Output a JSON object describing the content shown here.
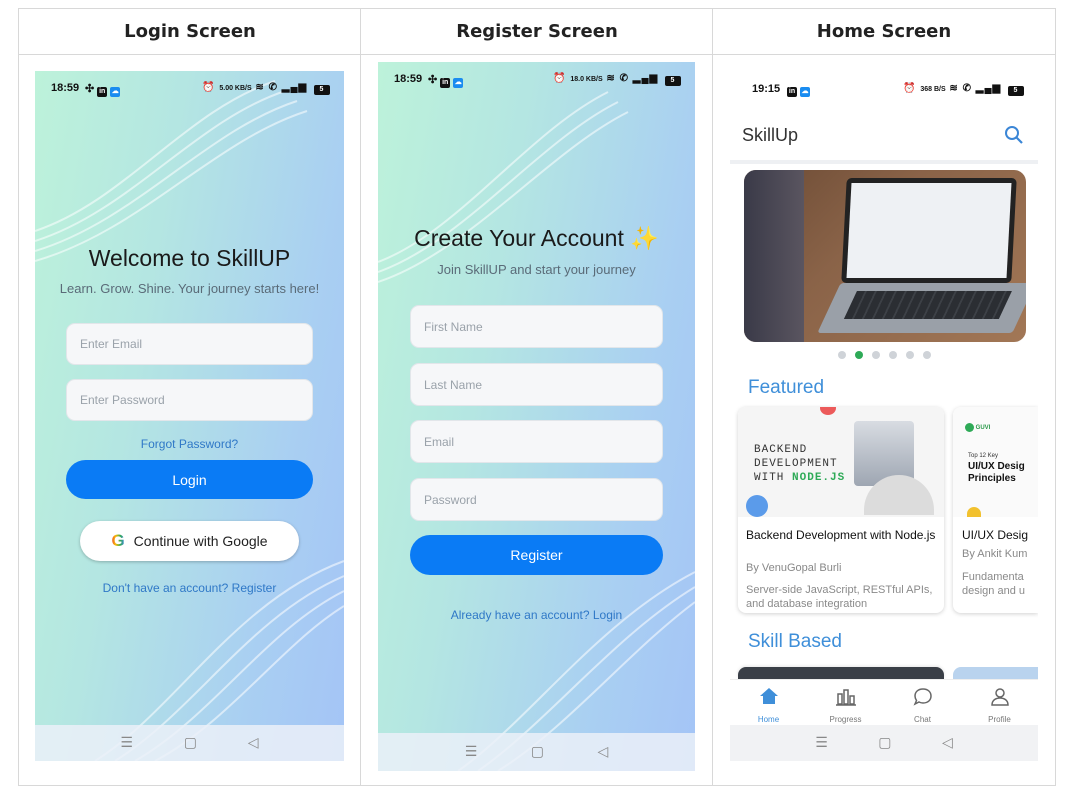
{
  "columns": [
    "Login Screen",
    "Register Screen",
    "Home Screen"
  ],
  "login": {
    "time": "18:59",
    "status_right": "5.00 KB/S",
    "battery": "5",
    "title": "Welcome to SkillUP",
    "subtitle": "Learn. Grow. Shine. Your journey starts here!",
    "email_placeholder": "Enter Email",
    "password_placeholder": "Enter Password",
    "forgot": "Forgot Password?",
    "login_button": "Login",
    "google_button": "Continue with Google",
    "register_link": "Don't have an account? Register"
  },
  "register": {
    "time": "18:59",
    "status_right": "18.0 KB/S",
    "battery": "5",
    "title": "Create Your Account ✨",
    "subtitle": "Join SkillUP and start your journey",
    "first_name": "First Name",
    "last_name": "Last Name",
    "email": "Email",
    "password": "Password",
    "register_button": "Register",
    "login_link": "Already have an account? Login"
  },
  "home": {
    "time": "19:15",
    "status_right": "368 B/S",
    "battery": "5",
    "app_title": "SkillUp",
    "featured_heading": "Featured",
    "skill_heading": "Skill Based",
    "carousel_dots": 6,
    "carousel_active": 1,
    "accent": "#0a7bf5",
    "cards": [
      {
        "banner_line1": "BACKEND",
        "banner_line2": "DEVELOPMENT",
        "banner_line3_prefix": "WITH ",
        "banner_line3_accent": "NODE.JS",
        "title": "Backend Development with Node.js",
        "author": "By VenuGopal Burli",
        "description": "Server-side JavaScript, RESTful APIs, and database integration"
      },
      {
        "badge": "GUVI",
        "banner_small": "Top 12 Key",
        "banner_title": "UI/UX Desig Principles",
        "title": "UI/UX Desig",
        "author": "By Ankit Kum",
        "description": "Fundamenta design and u"
      }
    ],
    "nav": [
      "Home",
      "Progress",
      "Chat",
      "Profile"
    ]
  }
}
